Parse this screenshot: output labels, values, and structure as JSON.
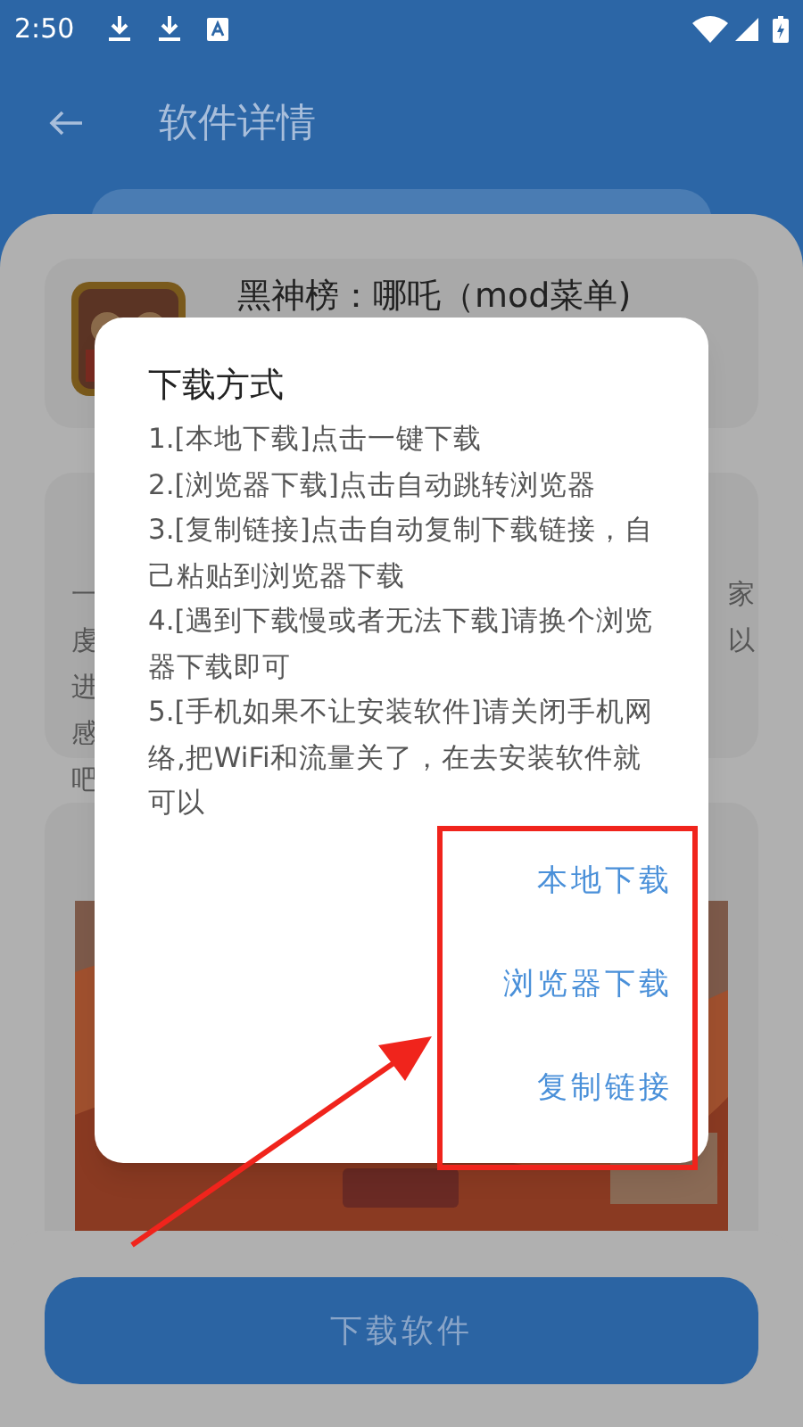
{
  "status_bar": {
    "time": "2:50"
  },
  "app_bar": {
    "title": "软件详情"
  },
  "app_card": {
    "title": "黑神榜：哪吒（mod菜单)"
  },
  "intro_card": {
    "left_fragments": [
      "一",
      "虔",
      "进",
      "感",
      "吧"
    ],
    "right_fragments": [
      "家",
      "以"
    ]
  },
  "download_button": {
    "label": "下载软件"
  },
  "dialog": {
    "title": "下载方式",
    "lines": [
      "1.[本地下载]点击一键下载",
      "2.[浏览器下载]点击自动跳转浏览器",
      "3.[复制链接]点击自动复制下载链接，自己粘贴到浏览器下载",
      "4.[遇到下载慢或者无法下载]请换个浏览器下载即可",
      "5.[手机如果不让安装软件]请关闭手机网络,把WiFi和流量关了，在去安装软件就可以"
    ],
    "actions": [
      "本地下载",
      "浏览器下载",
      "复制链接"
    ]
  }
}
